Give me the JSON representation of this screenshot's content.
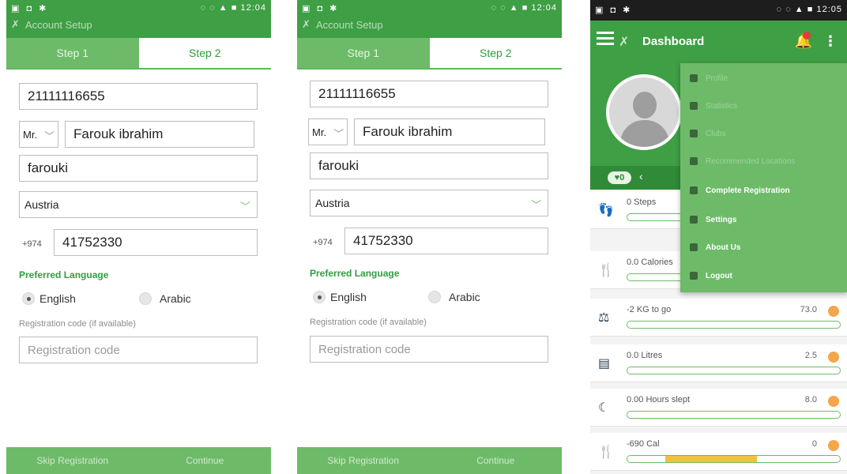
{
  "status_bar": {
    "left_icons": "▣ ◘ ✱",
    "right_icons": "◌ ◌ ▲ ■",
    "time_1": "12:04",
    "time_2": "12:04",
    "time_3": "12:05"
  },
  "account_setup": {
    "title": "Account Setup",
    "tab_step1": "Step 1",
    "tab_step2": "Step 2",
    "id_value": "21111116655",
    "title_select": "Mr.",
    "name_value": "Farouk ibrahim",
    "username_value": "farouki",
    "country_value": "Austria",
    "phone_prefix": "+974",
    "phone_value": "41752330",
    "preferred_language_label": "Preferred Language",
    "lang_english": "English",
    "lang_arabic": "Arabic",
    "reg_code_label": "Registration code (if available)",
    "reg_code_placeholder": "Registration code",
    "skip_label": "Skip Registration",
    "continue_label": "Continue"
  },
  "dashboard": {
    "title": "Dashboard",
    "stat_pill": "0",
    "menu": {
      "profile": "Profile",
      "statistics": "Statistics",
      "clubs": "Clubs",
      "recommended": "Recommended Locations",
      "complete_registration": "Complete Registration",
      "settings": "Settings",
      "about": "About Us",
      "logout": "Logout"
    },
    "cards": [
      {
        "label": "0 Steps",
        "value": "",
        "fill": 0
      },
      {
        "label": "0.0 Calories",
        "value": "",
        "fill": 0
      },
      {
        "label": "-2 KG to go",
        "value": "73.0",
        "fill": 0
      },
      {
        "label": "0.0 Litres",
        "value": "2.5",
        "fill": 0
      },
      {
        "label": "0.00 Hours slept",
        "value": "8.0",
        "fill": 0
      },
      {
        "label": "-690 Cal",
        "value": "0",
        "fill": 0.43
      }
    ]
  }
}
